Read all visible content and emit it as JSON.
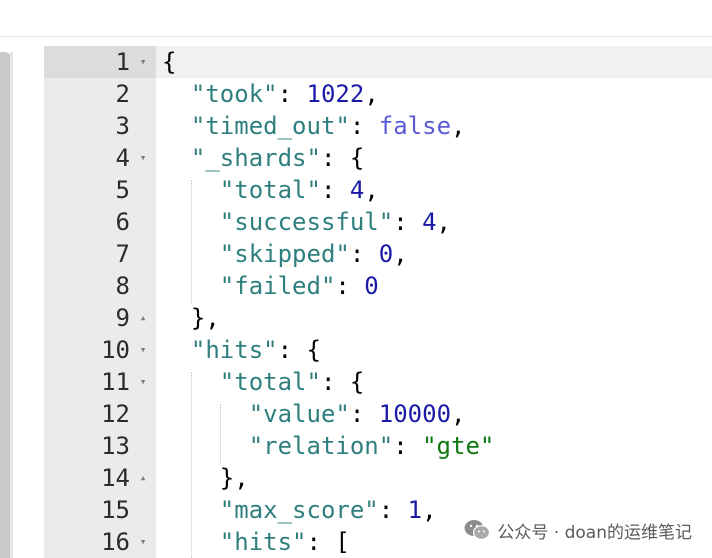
{
  "watermark": {
    "text": "公众号 · doan的运维笔记",
    "icon": "wechat-icon"
  },
  "colors": {
    "key": "#2f7f7f",
    "number": "#1a1aa6",
    "boolean": "#5b5bd6",
    "string": "#117711",
    "gutter": "#ebebeb"
  },
  "lines": [
    {
      "num": "1",
      "fold": "▾",
      "parts": [
        [
          "p",
          "{"
        ]
      ]
    },
    {
      "num": "2",
      "fold": "",
      "parts": [
        [
          "p",
          "  "
        ],
        [
          "k",
          "\"took\""
        ],
        [
          "p",
          ": "
        ],
        [
          "n",
          "1022"
        ],
        [
          "p",
          ","
        ]
      ]
    },
    {
      "num": "3",
      "fold": "",
      "parts": [
        [
          "p",
          "  "
        ],
        [
          "k",
          "\"timed_out\""
        ],
        [
          "p",
          ": "
        ],
        [
          "b",
          "false"
        ],
        [
          "p",
          ","
        ]
      ]
    },
    {
      "num": "4",
      "fold": "▾",
      "parts": [
        [
          "p",
          "  "
        ],
        [
          "k",
          "\"_shards\""
        ],
        [
          "p",
          ": {"
        ]
      ]
    },
    {
      "num": "5",
      "fold": "",
      "parts": [
        [
          "p",
          "    "
        ],
        [
          "k",
          "\"total\""
        ],
        [
          "p",
          ": "
        ],
        [
          "n",
          "4"
        ],
        [
          "p",
          ","
        ]
      ]
    },
    {
      "num": "6",
      "fold": "",
      "parts": [
        [
          "p",
          "    "
        ],
        [
          "k",
          "\"successful\""
        ],
        [
          "p",
          ": "
        ],
        [
          "n",
          "4"
        ],
        [
          "p",
          ","
        ]
      ]
    },
    {
      "num": "7",
      "fold": "",
      "parts": [
        [
          "p",
          "    "
        ],
        [
          "k",
          "\"skipped\""
        ],
        [
          "p",
          ": "
        ],
        [
          "n",
          "0"
        ],
        [
          "p",
          ","
        ]
      ]
    },
    {
      "num": "8",
      "fold": "",
      "parts": [
        [
          "p",
          "    "
        ],
        [
          "k",
          "\"failed\""
        ],
        [
          "p",
          ": "
        ],
        [
          "n",
          "0"
        ]
      ]
    },
    {
      "num": "9",
      "fold": "▴",
      "parts": [
        [
          "p",
          "  },"
        ]
      ]
    },
    {
      "num": "10",
      "fold": "▾",
      "parts": [
        [
          "p",
          "  "
        ],
        [
          "k",
          "\"hits\""
        ],
        [
          "p",
          ": {"
        ]
      ]
    },
    {
      "num": "11",
      "fold": "▾",
      "parts": [
        [
          "p",
          "    "
        ],
        [
          "k",
          "\"total\""
        ],
        [
          "p",
          ": {"
        ]
      ]
    },
    {
      "num": "12",
      "fold": "",
      "parts": [
        [
          "p",
          "      "
        ],
        [
          "k",
          "\"value\""
        ],
        [
          "p",
          ": "
        ],
        [
          "n",
          "10000"
        ],
        [
          "p",
          ","
        ]
      ]
    },
    {
      "num": "13",
      "fold": "",
      "parts": [
        [
          "p",
          "      "
        ],
        [
          "k",
          "\"relation\""
        ],
        [
          "p",
          ": "
        ],
        [
          "s",
          "\"gte\""
        ]
      ]
    },
    {
      "num": "14",
      "fold": "▴",
      "parts": [
        [
          "p",
          "    },"
        ]
      ]
    },
    {
      "num": "15",
      "fold": "",
      "parts": [
        [
          "p",
          "    "
        ],
        [
          "k",
          "\"max_score\""
        ],
        [
          "p",
          ": "
        ],
        [
          "n",
          "1"
        ],
        [
          "p",
          ","
        ]
      ]
    },
    {
      "num": "16",
      "fold": "▾",
      "parts": [
        [
          "p",
          "    "
        ],
        [
          "k",
          "\"hits\""
        ],
        [
          "p",
          ": ["
        ]
      ]
    }
  ]
}
